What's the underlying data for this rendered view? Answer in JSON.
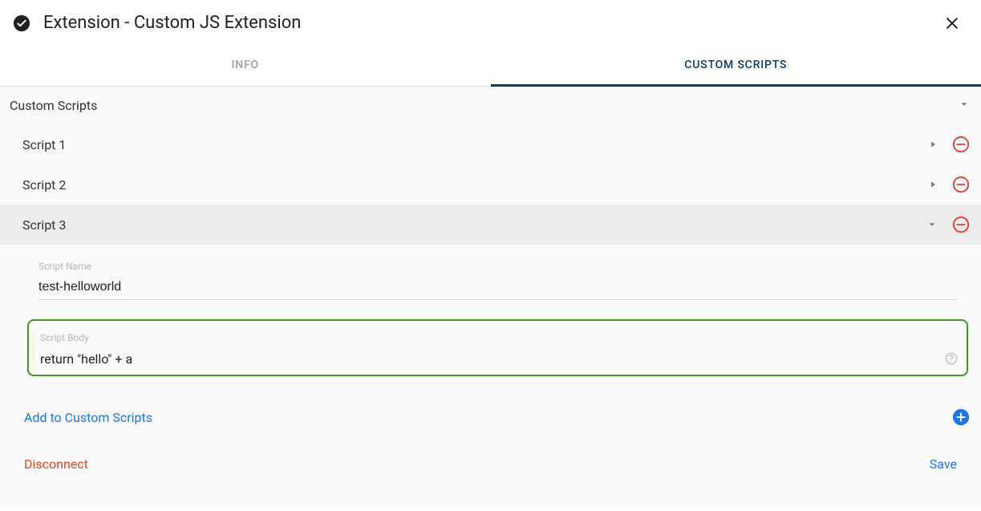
{
  "header": {
    "title": "Extension - Custom JS Extension"
  },
  "tabs": {
    "info": "INFO",
    "custom_scripts": "CUSTOM SCRIPTS"
  },
  "section": {
    "title": "Custom Scripts"
  },
  "scripts": [
    {
      "label": "Script 1",
      "expanded": false
    },
    {
      "label": "Script 2",
      "expanded": false
    },
    {
      "label": "Script 3",
      "expanded": true
    }
  ],
  "detail": {
    "name_label": "Script Name",
    "name_value": "test-helloworld",
    "body_label": "Script Body",
    "body_value": "return \"hello\" + a"
  },
  "actions": {
    "add": "Add to Custom Scripts",
    "disconnect": "Disconnect",
    "save": "Save"
  },
  "icons": {
    "check": "check-circle-icon",
    "close": "close-icon",
    "caret_down": "caret-down-icon",
    "play": "play-icon",
    "remove": "remove-circle-icon",
    "help": "help-icon",
    "add": "add-circle-icon"
  }
}
